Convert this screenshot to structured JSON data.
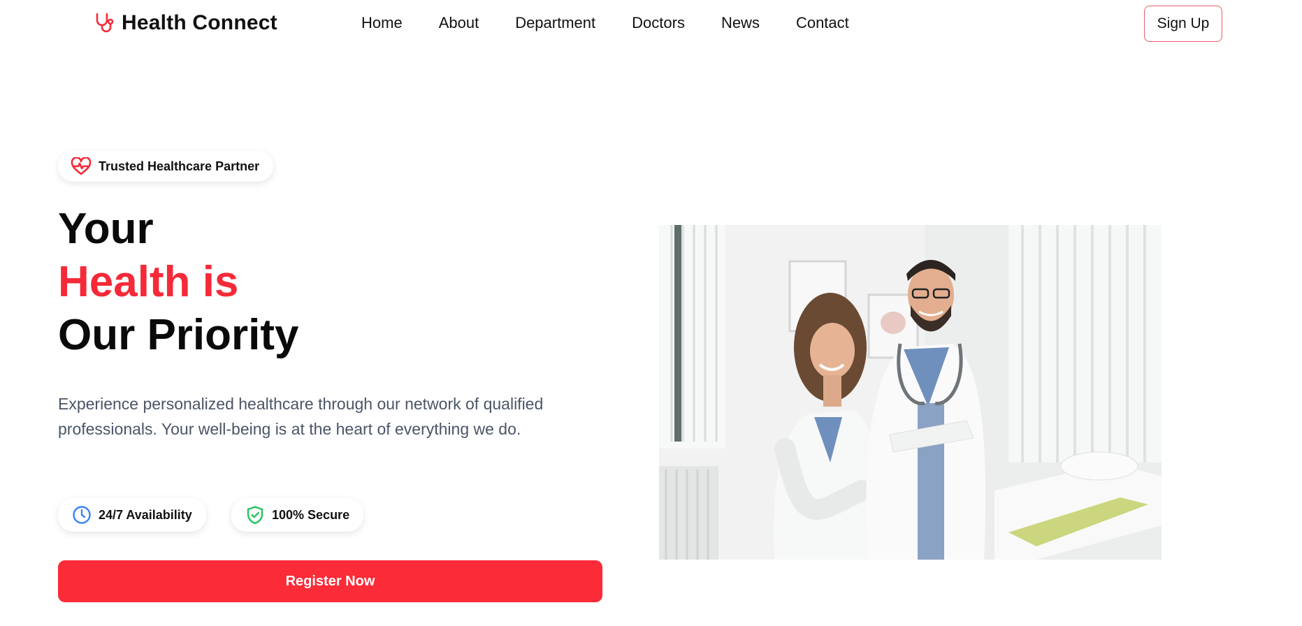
{
  "brand": {
    "name": "Health Connect",
    "icon": "stethoscope-icon",
    "accent_color": "#f52a38"
  },
  "nav": {
    "items": [
      {
        "label": "Home"
      },
      {
        "label": "About"
      },
      {
        "label": "Department"
      },
      {
        "label": "Doctors"
      },
      {
        "label": "News"
      },
      {
        "label": "Contact"
      }
    ],
    "signup_label": "Sign Up"
  },
  "hero": {
    "badge": {
      "icon": "heart-pulse-icon",
      "label": "Trusted Healthcare Partner"
    },
    "headline": {
      "line1": "Your",
      "line2": "Health is",
      "line3": "Our Priority"
    },
    "description": "Experience personalized healthcare through our network of qualified professionals. Your well-being is at the heart of everything we do.",
    "features": [
      {
        "icon": "clock-icon",
        "label": "24/7 Availability",
        "icon_color": "#3b82f6"
      },
      {
        "icon": "shield-check-icon",
        "label": "100% Secure",
        "icon_color": "#22c55e"
      }
    ],
    "cta_label": "Register Now",
    "cta_color": "#fc2b38",
    "image": {
      "subject": "two-doctors-photo"
    }
  }
}
